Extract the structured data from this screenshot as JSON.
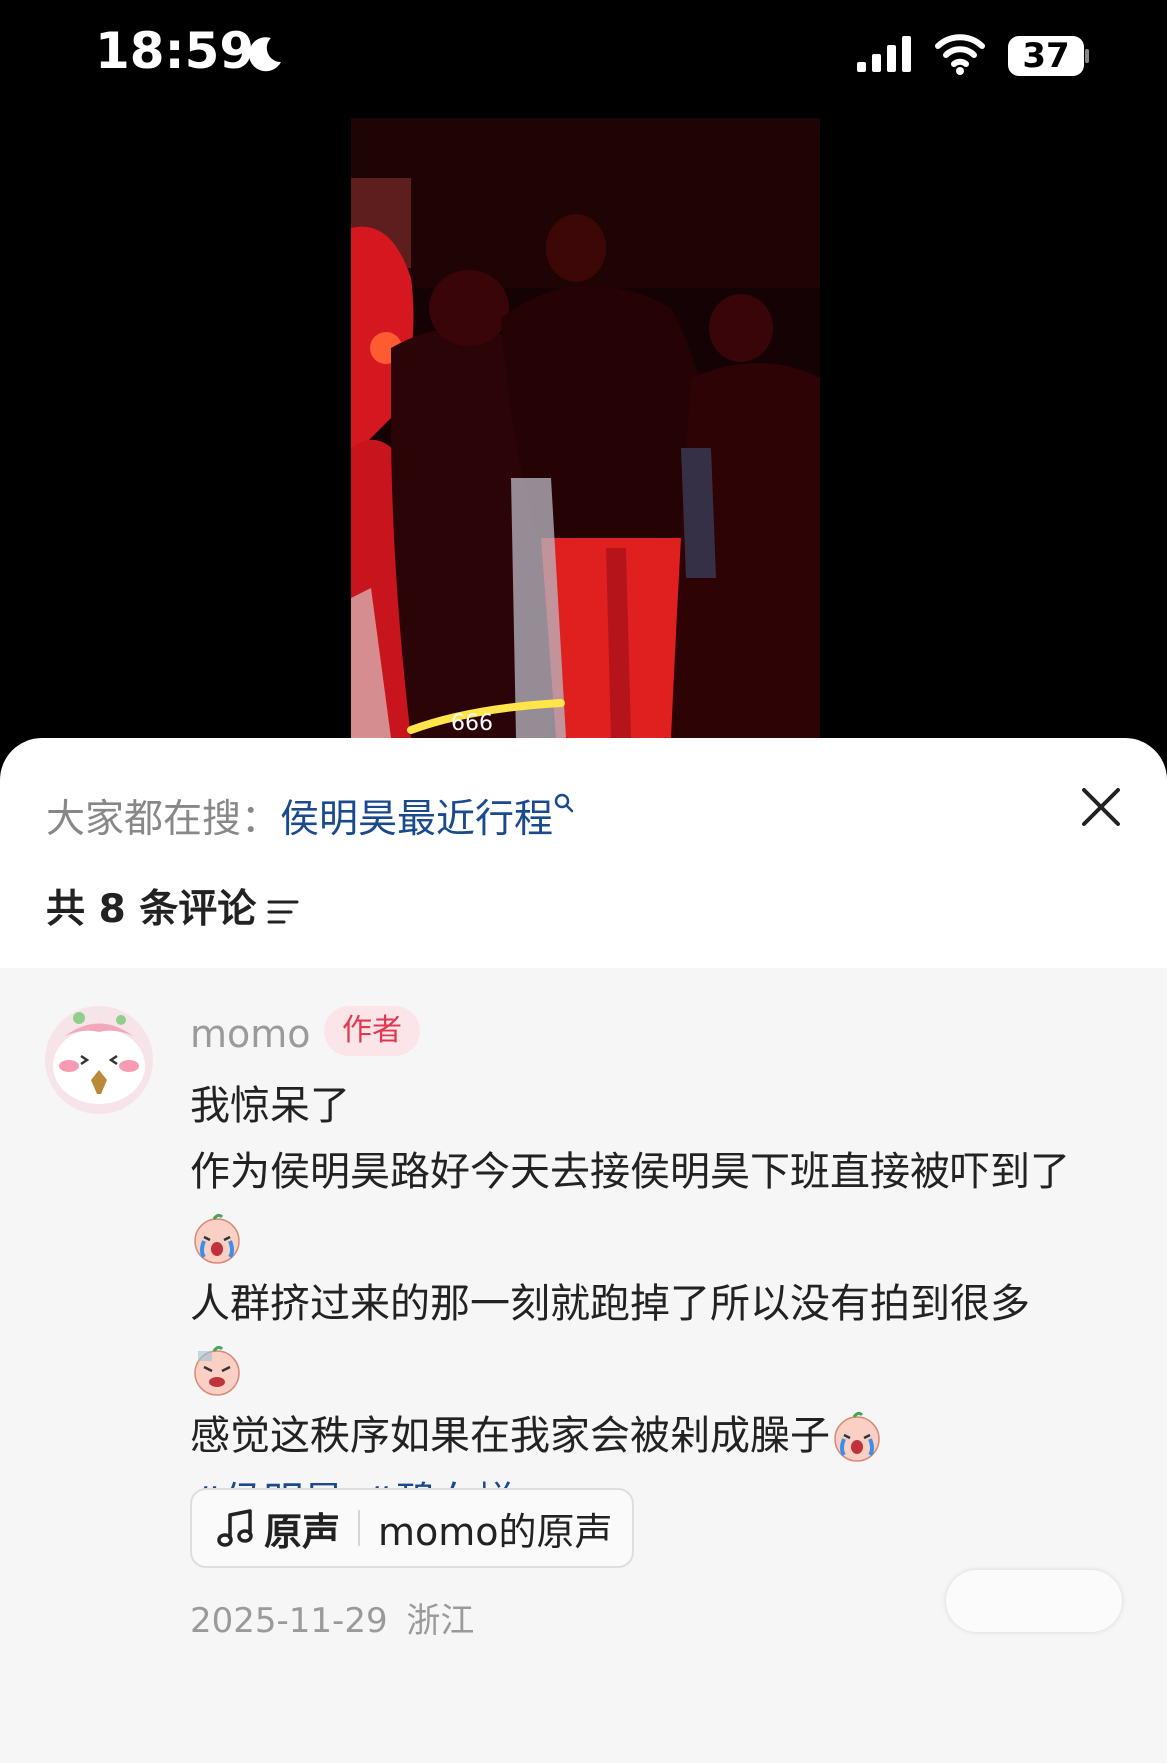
{
  "status_bar": {
    "time": "18:59",
    "battery": "37"
  },
  "video": {
    "overlay_text": "666"
  },
  "panel": {
    "search_prefix": "大家都在搜：",
    "search_keyword": "侯明昊最近行程",
    "comment_count": "共 8 条评论"
  },
  "comment": {
    "author": "momo",
    "badge": "作者",
    "lines": [
      "我惊呆了",
      "作为侯明昊路好今天去接侯明昊下班直接被吓到了",
      "人群挤过来的那一刻就跑掉了所以没有拍到很多",
      "感觉这秩序如果在我家会被剁成臊子"
    ],
    "hashtags": [
      "#侯明昊",
      "#碧血蝉"
    ],
    "sound": {
      "kind": "原声",
      "title": "momo的原声"
    },
    "date": "2025-11-29",
    "location": "浙江"
  }
}
